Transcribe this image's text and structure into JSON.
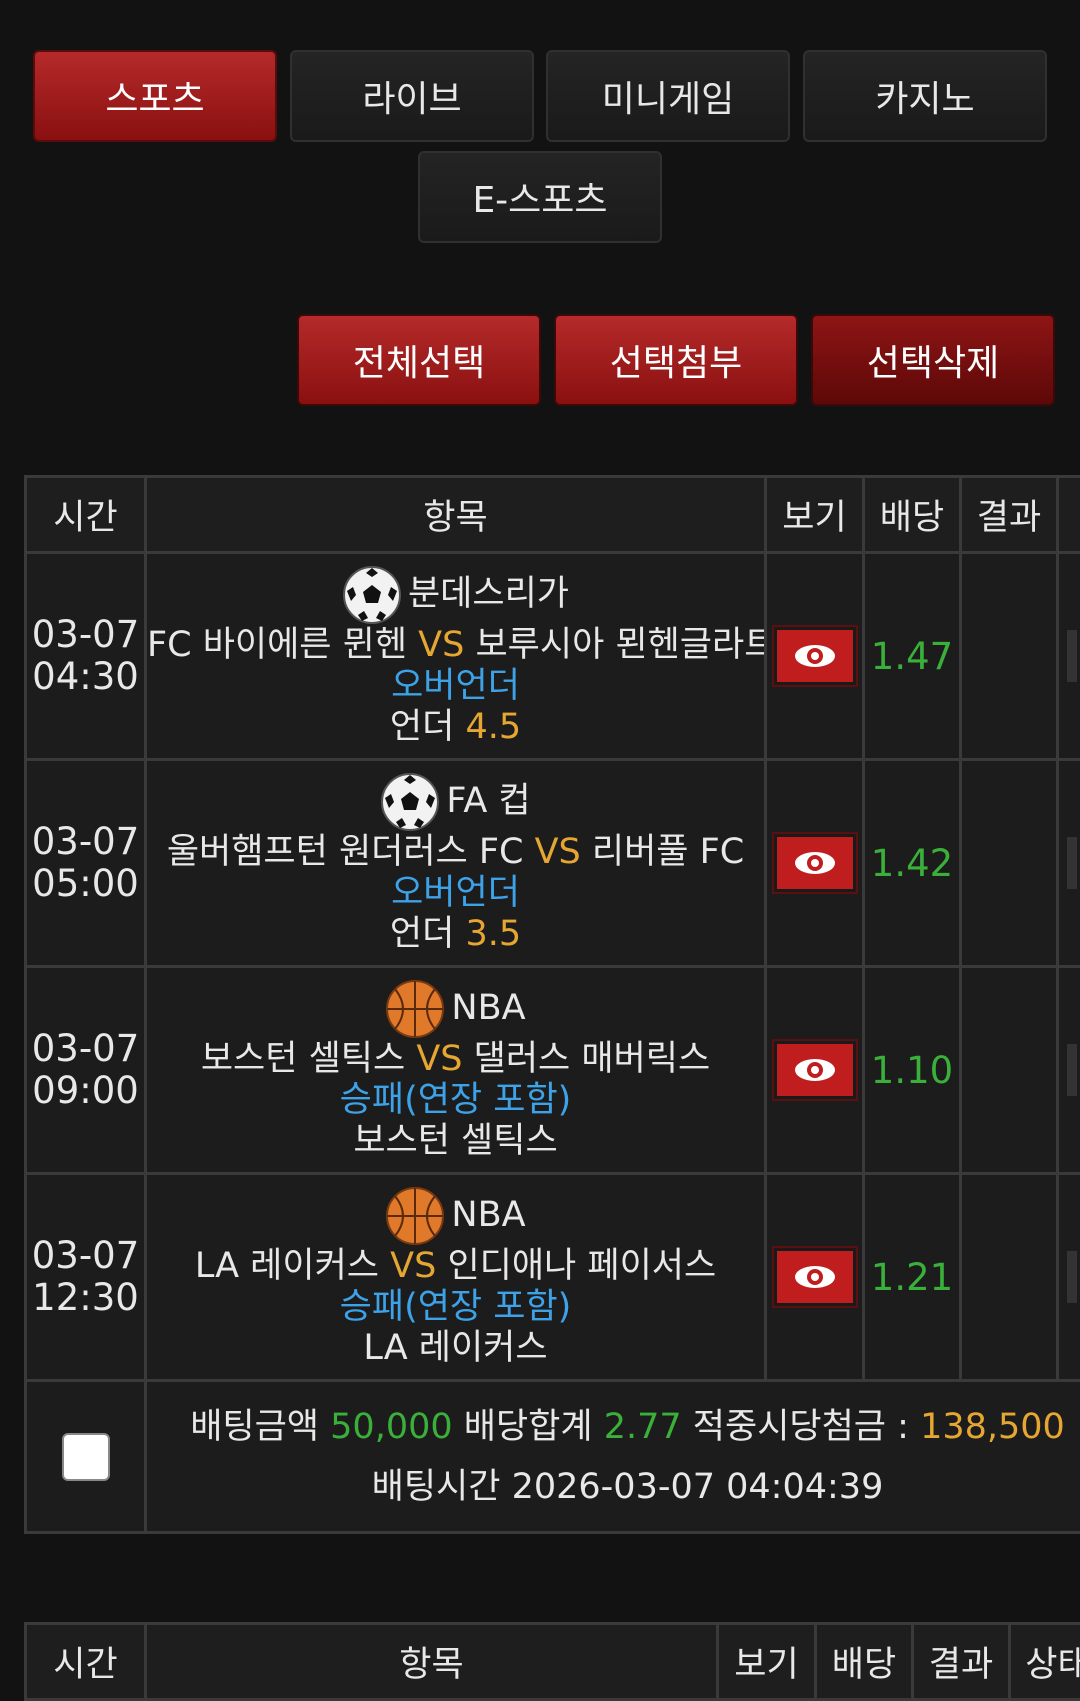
{
  "tabs": [
    "스포츠",
    "라이브",
    "미니게임",
    "카지노",
    "E-스포츠"
  ],
  "actions": [
    "전체선택",
    "선택첨부",
    "선택삭제"
  ],
  "table": {
    "headers": [
      "시간",
      "항목",
      "보기",
      "배당",
      "결과"
    ],
    "rows": [
      {
        "date": "03-07",
        "time": "04:30",
        "sport": "soccer",
        "league": "분데스리가",
        "home": "FC 바이에른 뮌헨",
        "vs": "VS",
        "away": "보루시아 묀헨글라트",
        "market": "오버언더",
        "pick": "언더",
        "pick_value": "4.5",
        "odds": "1.47"
      },
      {
        "date": "03-07",
        "time": "05:00",
        "sport": "soccer",
        "league": "FA 컵",
        "home": "울버햄프턴 원더러스 FC",
        "vs": "VS",
        "away": "리버풀 FC",
        "market": "오버언더",
        "pick": "언더",
        "pick_value": "3.5",
        "odds": "1.42"
      },
      {
        "date": "03-07",
        "time": "09:00",
        "sport": "basketball",
        "league": "NBA",
        "home": "보스턴 셀틱스",
        "vs": "VS",
        "away": "댈러스 매버릭스",
        "market": "승패(연장 포함)",
        "pick": "보스턴 셀틱스",
        "pick_value": "",
        "odds": "1.10"
      },
      {
        "date": "03-07",
        "time": "12:30",
        "sport": "basketball",
        "league": "NBA",
        "home": "LA 레이커스",
        "vs": "VS",
        "away": "인디애나 페이서스",
        "market": "승패(연장 포함)",
        "pick": "LA 레이커스",
        "pick_value": "",
        "odds": "1.21"
      }
    ],
    "summary": {
      "bet_amount_label": "배팅금액",
      "bet_amount": "50,000",
      "odds_total_label": "배당합계",
      "odds_total": "2.77",
      "payout_label": "적중시당첨금 :",
      "payout": "138,500",
      "bet_time_label": "배팅시간",
      "bet_time": "2026-03-07 04:04:39"
    }
  },
  "table2": {
    "headers": [
      "시간",
      "항목",
      "보기",
      "배당",
      "결과",
      "상태"
    ]
  },
  "colors": {
    "accent_red": "#b52a2a",
    "odds_green": "#3ab03a",
    "vs_orange": "#e6a632",
    "market_blue": "#3da2e8"
  }
}
